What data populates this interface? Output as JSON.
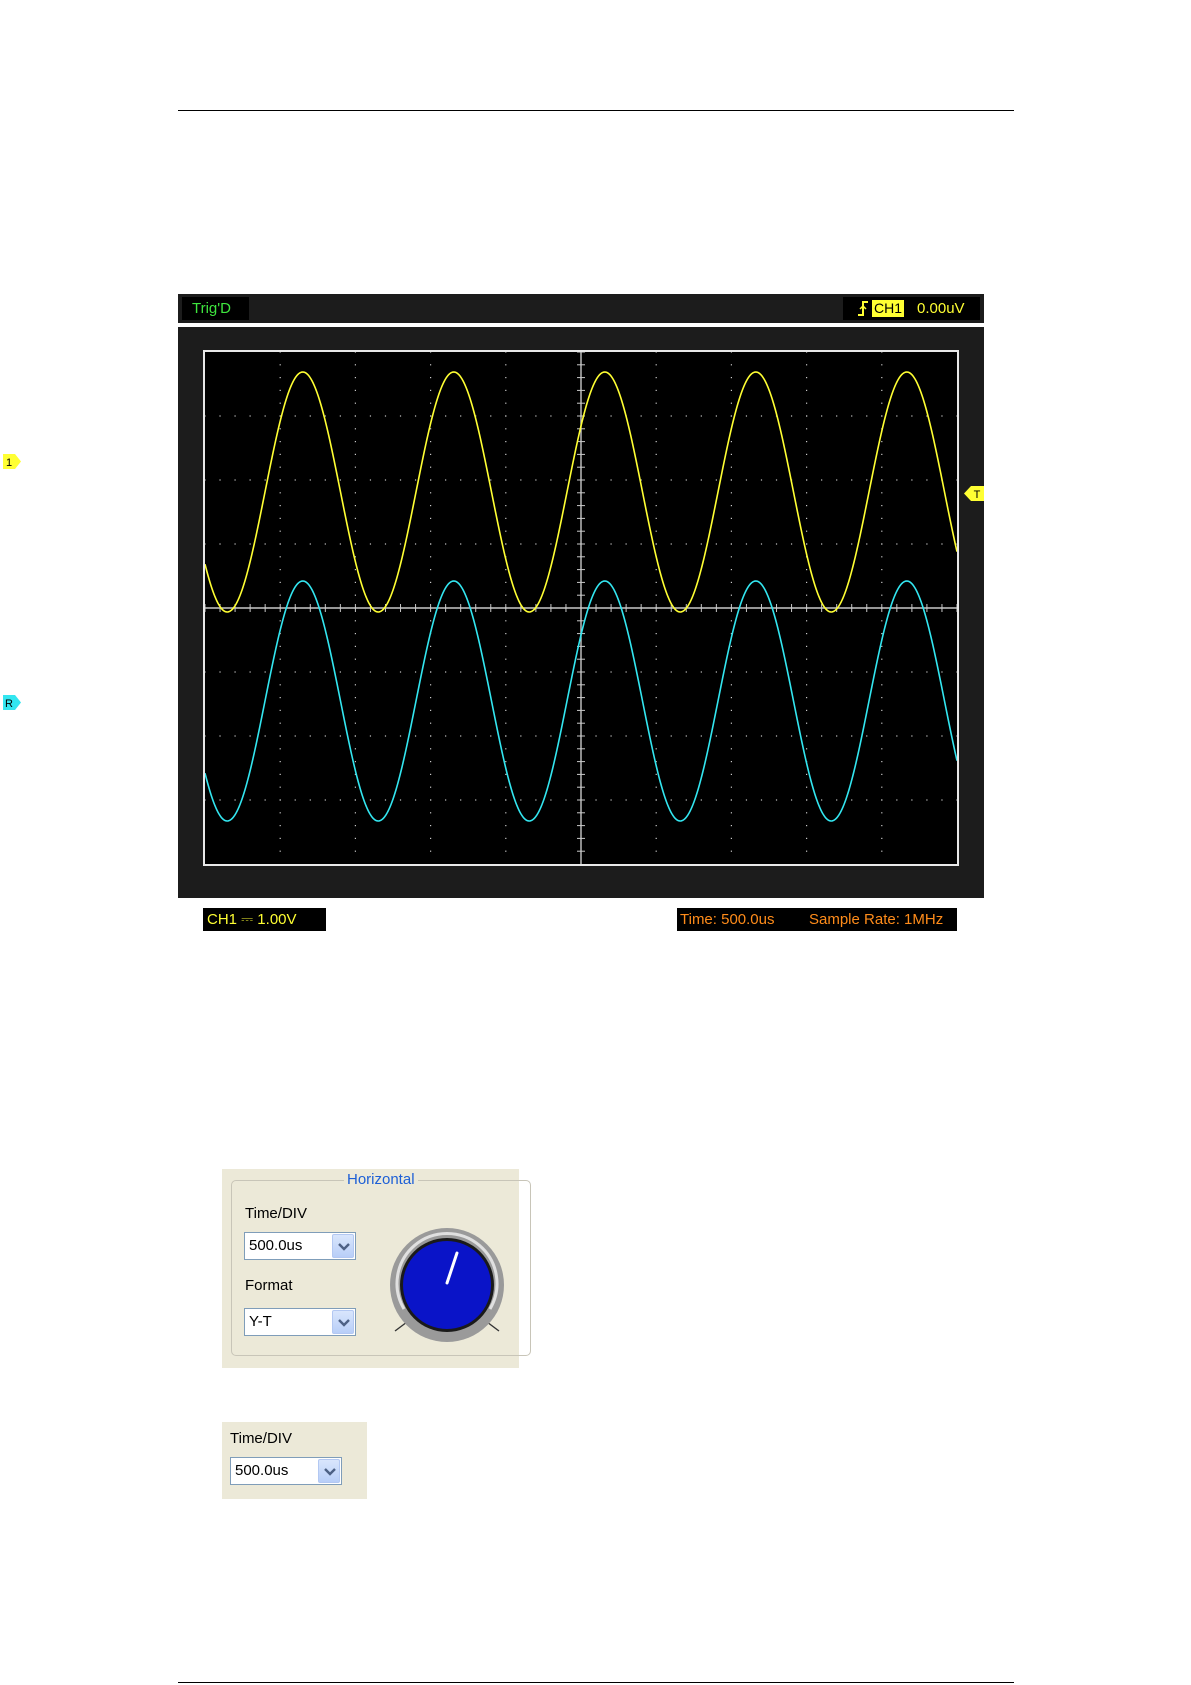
{
  "scope": {
    "trigger_state": "Trig'D",
    "trigger_channel": "CH1",
    "trigger_level": "0.00uV",
    "trigger_edge_icon": "rising-edge-icon",
    "marker_ch1": "1",
    "marker_ref": "R",
    "marker_trigger": "T",
    "channel_scale": "CH1 ⎓ 1.00V",
    "time_label": "Time: 500.0us",
    "sample_rate_label": "Sample Rate: 1MHz",
    "colors": {
      "ch1": "#ffff33",
      "ref": "#33e6f0",
      "grid": "#c8c8c8",
      "trigger_text": "#3ee53e",
      "time_text": "#ff8c1a"
    }
  },
  "horizontal_panel": {
    "title": "Horizontal",
    "time_div_label": "Time/DIV",
    "time_div_value": "500.0us",
    "format_label": "Format",
    "format_value": "Y-T",
    "knob_icon": "rotary-knob-icon"
  },
  "time_div_panel": {
    "label": "Time/DIV",
    "value": "500.0us"
  }
}
